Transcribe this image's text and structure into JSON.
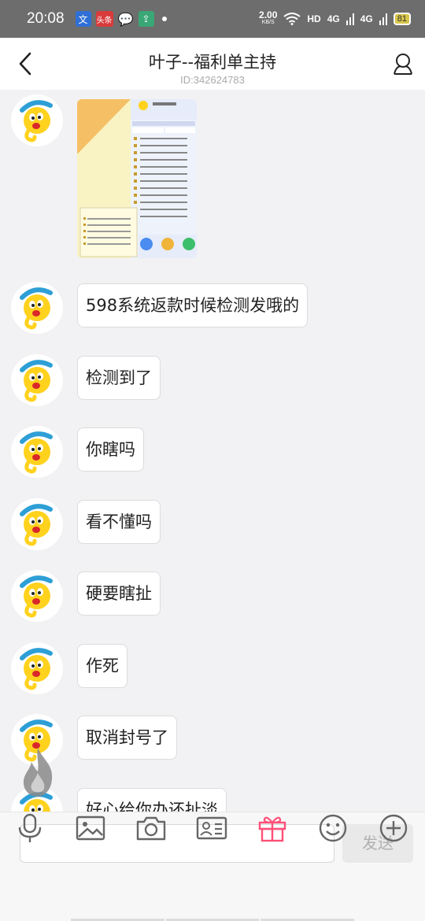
{
  "status_bar": {
    "time": "20:08",
    "notifications": [
      "文",
      "头条",
      "💬",
      "⇪"
    ],
    "speed_value": "2.00",
    "speed_unit": "KB/S",
    "hd_label": "HD",
    "signal_1": "4G",
    "signal_2": "4G",
    "battery": "81"
  },
  "header": {
    "title": "叶子--福利单主持",
    "subtitle": "ID:342624783"
  },
  "messages": [
    {
      "type": "image"
    },
    {
      "type": "text",
      "text": "598系统返款时候检测发哦的"
    },
    {
      "type": "text",
      "text": "检测到了"
    },
    {
      "type": "text",
      "text": "你瞎吗"
    },
    {
      "type": "text",
      "text": "看不懂吗"
    },
    {
      "type": "text",
      "text": "硬要瞎扯"
    },
    {
      "type": "text",
      "text": "作死"
    },
    {
      "type": "text",
      "text": "取消封号了"
    },
    {
      "type": "text",
      "text": "好心给你办还扯淡"
    }
  ],
  "input": {
    "value": "",
    "send_label": "发送"
  },
  "toolbar": {
    "icons": [
      "microphone-icon",
      "image-icon",
      "camera-icon",
      "contact-card-icon",
      "gift-icon",
      "emoji-icon",
      "plus-icon"
    ]
  },
  "colors": {
    "accent": "#ff4f78",
    "status_bar": "#6d6d6d",
    "background": "#f2f2f4"
  }
}
